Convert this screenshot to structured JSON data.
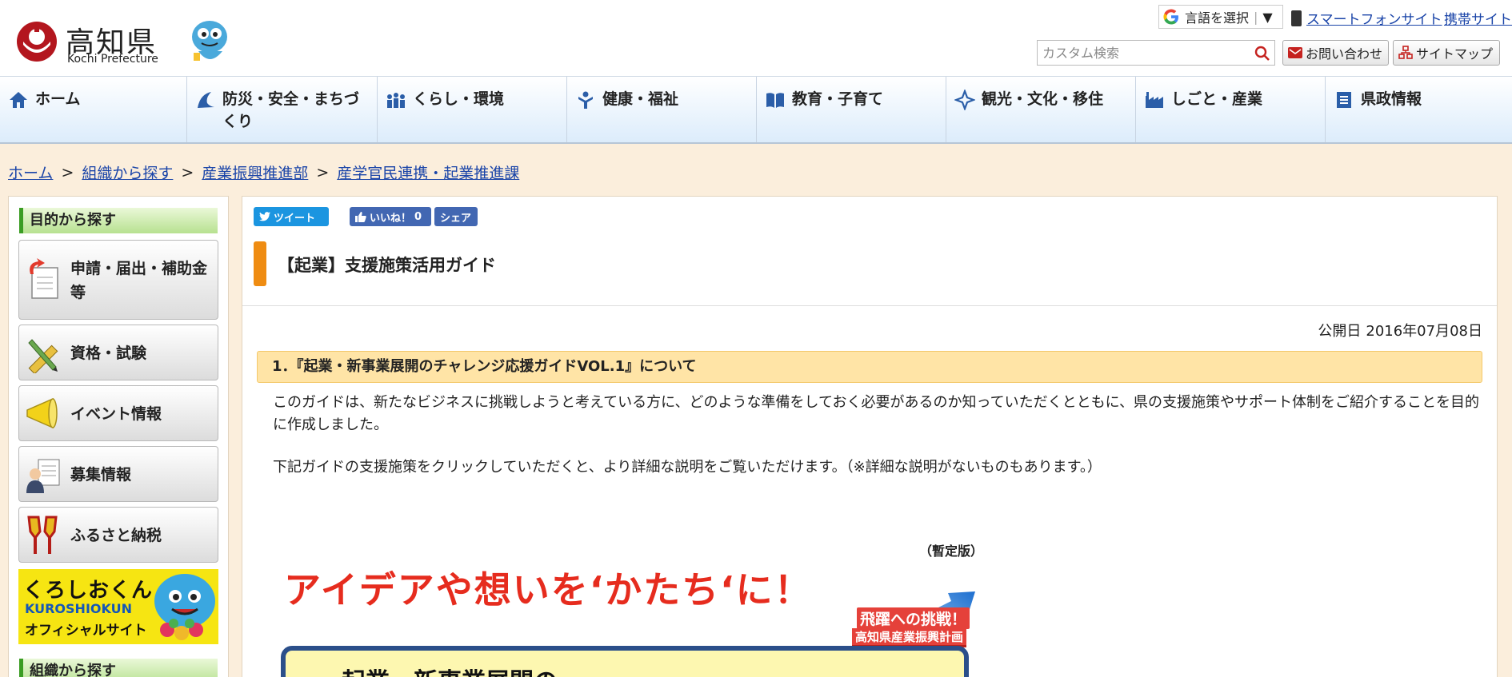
{
  "header": {
    "logo_title": "高知県",
    "logo_subtitle": "Kochi Prefecture",
    "language_select": "言語を選択",
    "language_arrow": "▼",
    "smartphone_link": "スマートフォンサイト",
    "mobile_link": "携帯サイト",
    "search_placeholder": "カスタム検索",
    "search_brand": "Google",
    "contact_label": "お問い合わせ",
    "sitemap_label": "サイトマップ"
  },
  "gnav": [
    {
      "label": "ホーム",
      "icon": "home-icon"
    },
    {
      "label": "防災・安全・まちづくり",
      "icon": "tsunami-icon"
    },
    {
      "label": "くらし・環境",
      "icon": "people-icon"
    },
    {
      "label": "健康・福祉",
      "icon": "health-icon"
    },
    {
      "label": "教育・子育て",
      "icon": "book-icon"
    },
    {
      "label": "観光・文化・移住",
      "icon": "sparkle-icon"
    },
    {
      "label": "しごと・産業",
      "icon": "factory-icon"
    },
    {
      "label": "県政情報",
      "icon": "document-icon"
    }
  ],
  "breadcrumb": {
    "items": [
      "ホーム",
      "組織から探す",
      "産業振興推進部",
      "産学官民連携・起業推進課"
    ],
    "separator": ">"
  },
  "sidebar": {
    "purpose_heading": "目的から探す",
    "buttons": [
      {
        "label": "申請・届出・補助金等",
        "icon": "application-form-icon"
      },
      {
        "label": "資格・試験",
        "icon": "pencil-ruler-icon"
      },
      {
        "label": "イベント情報",
        "icon": "megaphone-icon"
      },
      {
        "label": "募集情報",
        "icon": "recruit-icon"
      },
      {
        "label": "ふるさと納税",
        "icon": "naruko-clapper-icon"
      }
    ],
    "banner": {
      "line1": "くろしおくん",
      "line2": "KUROSHIOKUN",
      "line3": "オフィシャルサイト"
    },
    "org_heading": "組織から探す"
  },
  "main": {
    "share": {
      "tweet": "ツイート",
      "like": "いいね！",
      "like_count": "0",
      "share": "シェア"
    },
    "title": "【起業】支援施策活用ガイド",
    "published_label": "公開日",
    "published_date": "2016年07月08日",
    "section_heading": "1．『起業・新事業展開のチャレンジ応援ガイドVOL.1』について",
    "paragraph1": "このガイドは、新たなビジネスに挑戦しようと考えている方に、どのような準備をしておく必要があるのか知っていただくとともに、県の支援施策やサポート体制をご紹介することを目的に作成しました。",
    "paragraph2": "下記ガイドの支援施策をクリックしていただくと、より詳細な説明をご覧いただけます。（※詳細な説明がないものもあります。）",
    "guide_image": {
      "provisional": "（暫定版）",
      "headline": "アイデアや想いを‘かたち‘に！",
      "badge1": "飛躍への挑戦！",
      "badge2": "高知県産業振興計画",
      "subtitle": "起業・新事業展開の"
    }
  },
  "colors": {
    "nav_gradient_bottom": "#dcecfb",
    "page_background": "#fbeedc",
    "title_accent": "#ef8c12",
    "section_heading_bg": "#ffe4a6",
    "sidebar_heading_green": "#3a9d23",
    "link": "#1a44a8",
    "headline_red": "#e62c1e"
  }
}
